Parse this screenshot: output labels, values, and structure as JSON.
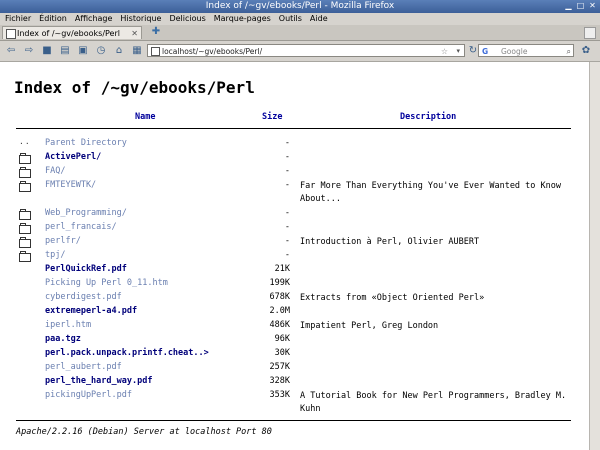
{
  "window": {
    "title": "Index of /~gv/ebooks/Perl - Mozilla Firefox"
  },
  "menu": [
    "Fichier",
    "Édition",
    "Affichage",
    "Historique",
    "Delicious",
    "Marque-pages",
    "Outils",
    "Aide"
  ],
  "tab": {
    "title": "Index of /~gv/ebooks/Perl"
  },
  "address": {
    "url": "localhost/~gv/ebooks/Perl/"
  },
  "search": {
    "engine_icon": "G",
    "placeholder": "Google"
  },
  "page": {
    "heading": "Index of /~gv/ebooks/Perl",
    "columns": {
      "name": "Name",
      "size": "Size",
      "description": "Description"
    },
    "rows": [
      {
        "icon": "parent-icon",
        "name": "Parent Directory",
        "size": "-",
        "desc": "",
        "bold": false
      },
      {
        "icon": "folder-icon",
        "name": "ActivePerl/",
        "size": "-",
        "desc": "",
        "bold": true
      },
      {
        "icon": "folder-icon",
        "name": "FAQ/",
        "size": "-",
        "desc": "",
        "bold": false
      },
      {
        "icon": "folder-icon",
        "name": "FMTEYEWTK/",
        "size": "-",
        "desc": "Far More Than Everything You've Ever Wanted to Know About...",
        "bold": false
      },
      {
        "icon": "folder-icon",
        "name": "Web_Programming/",
        "size": "-",
        "desc": "",
        "bold": false
      },
      {
        "icon": "folder-icon",
        "name": "perl_francais/",
        "size": "-",
        "desc": "",
        "bold": false
      },
      {
        "icon": "folder-icon",
        "name": "perlfr/",
        "size": "-",
        "desc": "Introduction à Perl, Olivier AUBERT",
        "bold": false
      },
      {
        "icon": "folder-icon",
        "name": "tpj/",
        "size": "-",
        "desc": "",
        "bold": false
      },
      {
        "icon": "none",
        "name": "PerlQuickRef.pdf",
        "size": "21K",
        "desc": "",
        "bold": true
      },
      {
        "icon": "none",
        "name": "Picking Up Perl 0_11.htm",
        "size": "199K",
        "desc": "",
        "bold": false
      },
      {
        "icon": "none",
        "name": "cyberdigest.pdf",
        "size": "678K",
        "desc": "Extracts from «Object Oriented Perl»",
        "bold": false
      },
      {
        "icon": "none",
        "name": "extremeperl-a4.pdf",
        "size": "2.0M",
        "desc": "",
        "bold": true
      },
      {
        "icon": "none",
        "name": "iperl.htm",
        "size": "486K",
        "desc": "Impatient Perl, Greg London",
        "bold": false
      },
      {
        "icon": "none",
        "name": "paa.tgz",
        "size": "96K",
        "desc": "",
        "bold": true
      },
      {
        "icon": "none",
        "name": "perl.pack.unpack.printf.cheat..>",
        "size": "30K",
        "desc": "",
        "bold": true
      },
      {
        "icon": "none",
        "name": "perl_aubert.pdf",
        "size": "257K",
        "desc": "",
        "bold": false
      },
      {
        "icon": "none",
        "name": "perl_the_hard_way.pdf",
        "size": "328K",
        "desc": "",
        "bold": true
      },
      {
        "icon": "none",
        "name": "pickingUpPerl.pdf",
        "size": "353K",
        "desc": "A Tutorial Book for New Perl Programmers, Bradley M. Kuhn",
        "bold": false
      }
    ],
    "footer": "Apache/2.2.16 (Debian) Server at localhost Port 80"
  }
}
